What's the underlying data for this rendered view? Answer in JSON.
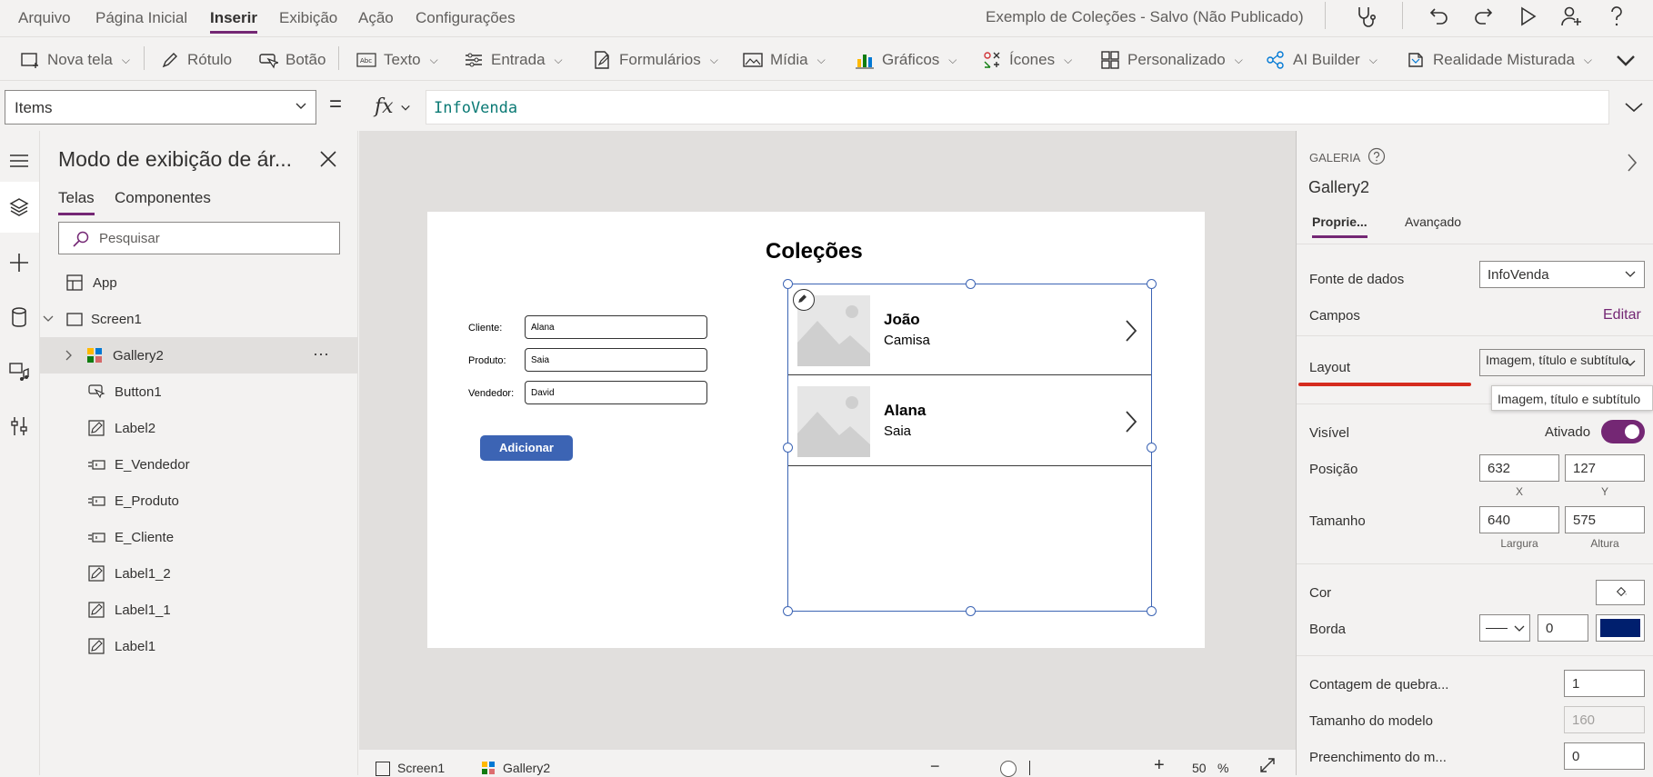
{
  "menu": {
    "items": [
      "Arquivo",
      "Página Inicial",
      "Inserir",
      "Exibição",
      "Ação",
      "Configurações"
    ],
    "active": "Inserir",
    "doc_title": "Exemplo de Coleções - Salvo (Não Publicado)"
  },
  "ribbon": {
    "nova_tela": "Nova tela",
    "rotulo": "Rótulo",
    "botao": "Botão",
    "texto": "Texto",
    "entrada": "Entrada",
    "formularios": "Formulários",
    "midia": "Mídia",
    "graficos": "Gráficos",
    "icones": "Ícones",
    "personalizado": "Personalizado",
    "ai_builder": "AI Builder",
    "realidade": "Realidade Misturada"
  },
  "formula": {
    "property": "Items",
    "equals": "=",
    "fx": "fx",
    "value": "InfoVenda"
  },
  "tree": {
    "title": "Modo de exibição de ár...",
    "tabs": [
      "Telas",
      "Componentes"
    ],
    "search_placeholder": "Pesquisar",
    "app": "App",
    "screen": "Screen1",
    "gallery": "Gallery2",
    "gallery_more": "···",
    "children": [
      "Button1",
      "Label2",
      "E_Vendedor",
      "E_Produto",
      "E_Cliente",
      "Label1_2",
      "Label1_1",
      "Label1"
    ]
  },
  "screen": {
    "title": "Coleções",
    "fields": [
      {
        "label": "Cliente:",
        "value": "Alana"
      },
      {
        "label": "Produto:",
        "value": "Saia"
      },
      {
        "label": "Vendedor:",
        "value": "David"
      }
    ],
    "add_button": "Adicionar",
    "gallery_items": [
      {
        "title": "João",
        "subtitle": "Camisa"
      },
      {
        "title": "Alana",
        "subtitle": "Saia"
      }
    ]
  },
  "statusbar": {
    "screen": "Screen1",
    "gallery": "Gallery2",
    "zoom_minus": "−",
    "zoom_plus": "+",
    "zoom_value": "50",
    "zoom_unit": "%"
  },
  "props": {
    "type_label": "GALERIA",
    "name": "Gallery2",
    "tabs": [
      "Proprie...",
      "Avançado"
    ],
    "fonte_label": "Fonte de dados",
    "fonte_value": "InfoVenda",
    "campos_label": "Campos",
    "campos_action": "Editar",
    "layout_label": "Layout",
    "layout_value": "Imagem, título e subtítulo",
    "tooltip": "Imagem, título e subtítulo",
    "visivel_label": "Visível",
    "visivel_value": "Ativado",
    "posicao_label": "Posição",
    "pos_x": "632",
    "pos_y": "127",
    "x_lbl": "X",
    "y_lbl": "Y",
    "tamanho_label": "Tamanho",
    "largura": "640",
    "altura": "575",
    "largura_lbl": "Largura",
    "altura_lbl": "Altura",
    "cor_label": "Cor",
    "borda_label": "Borda",
    "borda_value": "0",
    "quebra_label": "Contagem de quebra...",
    "quebra_value": "1",
    "modelo_label": "Tamanho do modelo",
    "modelo_value": "160",
    "preench_label": "Preenchimento do m...",
    "preench_value": "0"
  },
  "colors": {
    "accent": "#742774",
    "border_color": "#001f6e",
    "highlight": "#d52b1e"
  }
}
